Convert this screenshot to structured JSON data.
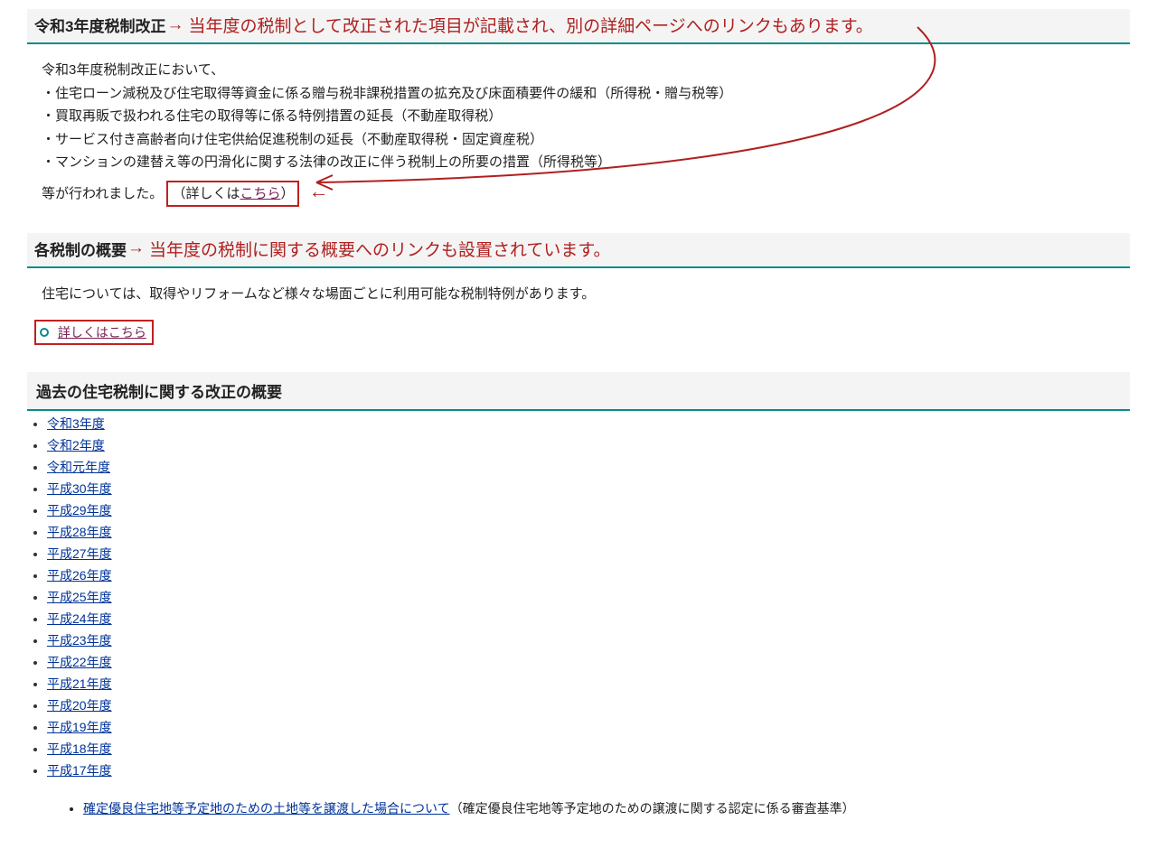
{
  "section1": {
    "title": "令和3年度税制改正",
    "annotation": "当年度の税制として改正された項目が記載され、別の詳細ページへのリンクもあります。",
    "intro": "令和3年度税制改正において、",
    "bullets": [
      "・住宅ローン減税及び住宅取得等資金に係る贈与税非課税措置の拡充及び床面積要件の緩和（所得税・贈与税等）",
      "・買取再販で扱われる住宅の取得等に係る特例措置の延長（不動産取得税）",
      "・サービス付き高齢者向け住宅供給促進税制の延長（不動産取得税・固定資産税）",
      "・マンションの建替え等の円滑化に関する法律の改正に伴う税制上の所要の措置（所得税等）"
    ],
    "outro_pre": "等が行われました。",
    "detail_pre": "（詳しくは",
    "detail_link": "こちら",
    "detail_post": "）"
  },
  "section2": {
    "title": "各税制の概要",
    "annotation": "当年度の税制に関する概要へのリンクも設置されています。",
    "body": "住宅については、取得やリフォームなど様々な場面ごとに利用可能な税制特例があります。",
    "link": "詳しくはこちら"
  },
  "section3": {
    "title": "過去の住宅税制に関する改正の概要",
    "years": [
      "令和3年度",
      "令和2年度",
      "令和元年度",
      "平成30年度",
      "平成29年度",
      "平成28年度",
      "平成27年度",
      "平成26年度",
      "平成25年度",
      "平成24年度",
      "平成23年度",
      "平成22年度",
      "平成21年度",
      "平成20年度",
      "平成19年度",
      "平成18年度",
      "平成17年度"
    ],
    "extra_link": "確定優良住宅地等予定地のための土地等を譲渡した場合について",
    "extra_suffix": "（確定優良住宅地等予定地のための譲渡に関する認定に係る審査基準）"
  }
}
